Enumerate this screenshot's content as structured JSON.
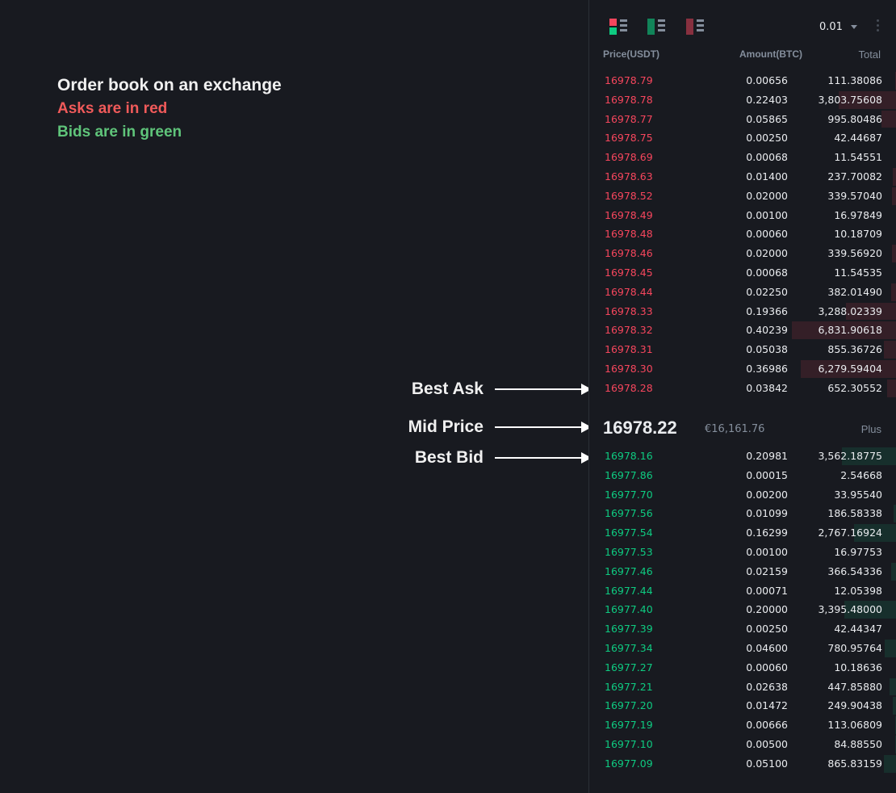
{
  "legend": {
    "title": "Order book on an exchange",
    "asks": "Asks are in red",
    "bids": "Bids are in green"
  },
  "annotations": {
    "best_ask": "Best Ask",
    "mid_price": "Mid Price",
    "best_bid": "Best Bid"
  },
  "toolbar": {
    "views": [
      "order-book-both-view-icon",
      "order-book-bids-view-icon",
      "order-book-asks-view-icon"
    ],
    "precision": "0.01",
    "more_icon": "more-vertical-icon"
  },
  "columns": {
    "price": "Price(USDT)",
    "amount": "Amount(BTC)",
    "total": "Total"
  },
  "colors": {
    "ask": "#f6465d",
    "bid": "#0ecb81",
    "background": "#181a20"
  },
  "asks": [
    {
      "price": "16978.79",
      "amount": "0.00656",
      "total": "111.38086"
    },
    {
      "price": "16978.78",
      "amount": "0.22403",
      "total": "3,803.75608"
    },
    {
      "price": "16978.77",
      "amount": "0.05865",
      "total": "995.80486"
    },
    {
      "price": "16978.75",
      "amount": "0.00250",
      "total": "42.44687"
    },
    {
      "price": "16978.69",
      "amount": "0.00068",
      "total": "11.54551"
    },
    {
      "price": "16978.63",
      "amount": "0.01400",
      "total": "237.70082"
    },
    {
      "price": "16978.52",
      "amount": "0.02000",
      "total": "339.57040"
    },
    {
      "price": "16978.49",
      "amount": "0.00100",
      "total": "16.97849"
    },
    {
      "price": "16978.48",
      "amount": "0.00060",
      "total": "10.18709"
    },
    {
      "price": "16978.46",
      "amount": "0.02000",
      "total": "339.56920"
    },
    {
      "price": "16978.45",
      "amount": "0.00068",
      "total": "11.54535"
    },
    {
      "price": "16978.44",
      "amount": "0.02250",
      "total": "382.01490"
    },
    {
      "price": "16978.33",
      "amount": "0.19366",
      "total": "3,288.02339"
    },
    {
      "price": "16978.32",
      "amount": "0.40239",
      "total": "6,831.90618"
    },
    {
      "price": "16978.31",
      "amount": "0.05038",
      "total": "855.36726"
    },
    {
      "price": "16978.30",
      "amount": "0.36986",
      "total": "6,279.59404"
    },
    {
      "price": "16978.28",
      "amount": "0.03842",
      "total": "652.30552"
    }
  ],
  "mid": {
    "price": "16978.22",
    "fiat": "€16,161.76",
    "more": "Plus"
  },
  "bids": [
    {
      "price": "16978.16",
      "amount": "0.20981",
      "total": "3,562.18775"
    },
    {
      "price": "16977.86",
      "amount": "0.00015",
      "total": "2.54668"
    },
    {
      "price": "16977.70",
      "amount": "0.00200",
      "total": "33.95540"
    },
    {
      "price": "16977.56",
      "amount": "0.01099",
      "total": "186.58338"
    },
    {
      "price": "16977.54",
      "amount": "0.16299",
      "total": "2,767.16924"
    },
    {
      "price": "16977.53",
      "amount": "0.00100",
      "total": "16.97753"
    },
    {
      "price": "16977.46",
      "amount": "0.02159",
      "total": "366.54336"
    },
    {
      "price": "16977.44",
      "amount": "0.00071",
      "total": "12.05398"
    },
    {
      "price": "16977.40",
      "amount": "0.20000",
      "total": "3,395.48000"
    },
    {
      "price": "16977.39",
      "amount": "0.00250",
      "total": "42.44347"
    },
    {
      "price": "16977.34",
      "amount": "0.04600",
      "total": "780.95764"
    },
    {
      "price": "16977.27",
      "amount": "0.00060",
      "total": "10.18636"
    },
    {
      "price": "16977.21",
      "amount": "0.02638",
      "total": "447.85880"
    },
    {
      "price": "16977.20",
      "amount": "0.01472",
      "total": "249.90438"
    },
    {
      "price": "16977.19",
      "amount": "0.00666",
      "total": "113.06809"
    },
    {
      "price": "16977.10",
      "amount": "0.00500",
      "total": "84.88550"
    },
    {
      "price": "16977.09",
      "amount": "0.05100",
      "total": "865.83159"
    }
  ]
}
